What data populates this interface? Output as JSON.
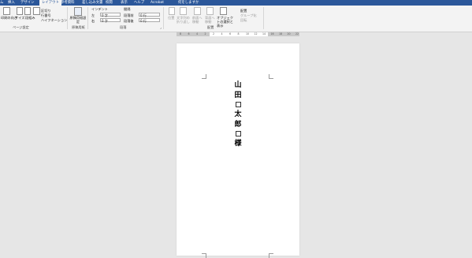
{
  "tabs": [
    {
      "label": "ム",
      "active": false
    },
    {
      "label": "挿入",
      "active": false
    },
    {
      "label": "デザイン",
      "active": false
    },
    {
      "label": "レイアウト",
      "active": true
    },
    {
      "label": "参考資料",
      "active": false
    },
    {
      "label": "差し込み文書",
      "active": false
    },
    {
      "label": "校閲",
      "active": false
    },
    {
      "label": "表示",
      "active": false
    },
    {
      "label": "ヘルプ",
      "active": false
    },
    {
      "label": "Acrobat",
      "active": false
    },
    {
      "label": "何をしますか",
      "active": false
    }
  ],
  "ribbon": {
    "page_setup": {
      "label": "ページ設定",
      "margins": "余白",
      "orientation": "印刷の向き",
      "size": "サイズ",
      "columns": "段組み",
      "breaks": "区切り",
      "line_numbers": "行番号",
      "hyphenation": "ハイフネーション"
    },
    "genko": {
      "label": "原稿用紙",
      "button": "原稿用紙設定"
    },
    "paragraph": {
      "label": "段落",
      "indent_heading": "インデント",
      "spacing_heading": "間隔",
      "left_label": "左",
      "right_label": "右",
      "before_label": "段落前",
      "after_label": "段落後",
      "left_value": "0 字",
      "right_value": "0 字",
      "before_value": "0 行",
      "after_value": "0 行"
    },
    "arrange": {
      "label": "配置",
      "position": "位置",
      "wrap": "文字列の折り返し",
      "forward": "前面へ移動",
      "backward": "背面へ移動",
      "selection_pane": "オブジェクトの選択と表示",
      "align": "配置",
      "group": "グループ化",
      "rotate": "回転"
    }
  },
  "ruler": [
    "8",
    "6",
    "4",
    "2",
    "2",
    "4",
    "6",
    "8",
    "10",
    "12",
    "14",
    "16",
    "18",
    "20",
    "22"
  ],
  "document": {
    "chars": [
      "山",
      "田",
      "",
      "太",
      "郎",
      "",
      "様"
    ],
    "paragraph_mark": "↵"
  }
}
